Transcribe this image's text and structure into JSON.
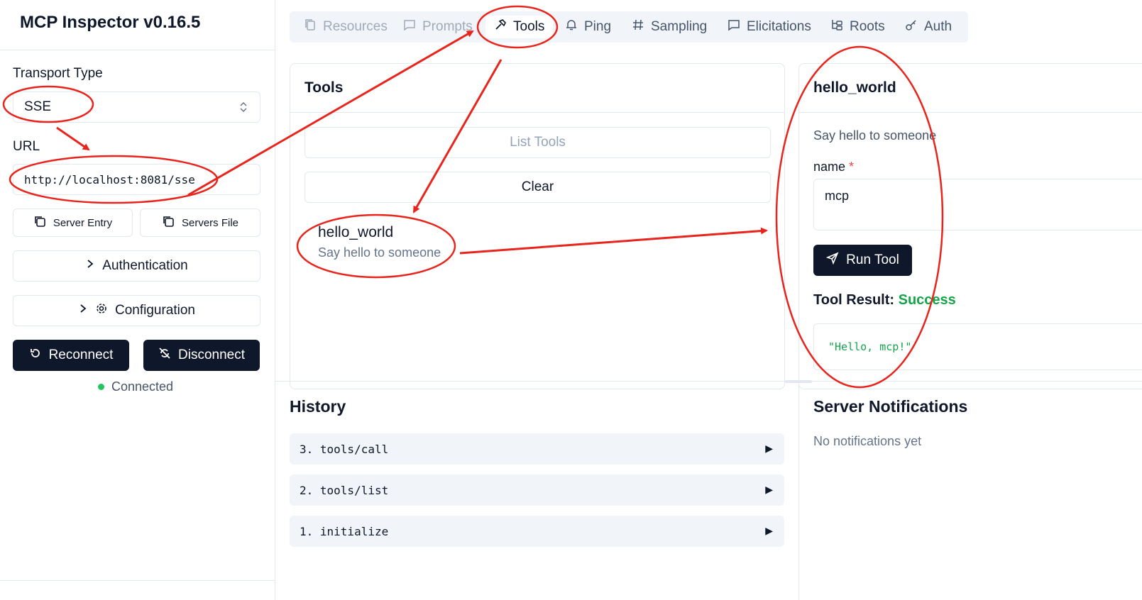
{
  "app": {
    "title": "MCP Inspector v0.16.5"
  },
  "sidebar": {
    "transport_label": "Transport Type",
    "transport_value": "SSE",
    "url_label": "URL",
    "url_value": "http://localhost:8081/sse",
    "server_entry_label": "Server Entry",
    "servers_file_label": "Servers File",
    "authentication_label": "Authentication",
    "configuration_label": "Configuration",
    "reconnect_label": "Reconnect",
    "disconnect_label": "Disconnect",
    "status_text": "Connected"
  },
  "tabs": [
    {
      "label": "Resources",
      "icon": "files-icon"
    },
    {
      "label": "Prompts",
      "icon": "message-icon"
    },
    {
      "label": "Tools",
      "icon": "hammer-icon"
    },
    {
      "label": "Ping",
      "icon": "bell-icon"
    },
    {
      "label": "Sampling",
      "icon": "hash-icon"
    },
    {
      "label": "Elicitations",
      "icon": "message-icon"
    },
    {
      "label": "Roots",
      "icon": "folder-tree-icon"
    },
    {
      "label": "Auth",
      "icon": "key-icon"
    }
  ],
  "tools_panel": {
    "title": "Tools",
    "list_button": "List Tools",
    "clear_button": "Clear",
    "tool_name": "hello_world",
    "tool_desc": "Say hello to someone"
  },
  "detail_panel": {
    "title": "hello_world",
    "description": "Say hello to someone",
    "param_label": "name",
    "required_mark": "*",
    "param_value": "mcp",
    "run_button": "Run Tool",
    "result_label": "Tool Result:",
    "result_status": "Success",
    "result_value": "\"Hello, mcp!\""
  },
  "history": {
    "title": "History",
    "items": [
      "3. tools/call",
      "2. tools/list",
      "1. initialize"
    ]
  },
  "notifications": {
    "title": "Server Notifications",
    "empty_text": "No notifications yet"
  },
  "colors": {
    "accent_dark": "#0f172a",
    "success": "#16a34a",
    "status_dot": "#22c55e",
    "annotation": "#e8241c"
  }
}
